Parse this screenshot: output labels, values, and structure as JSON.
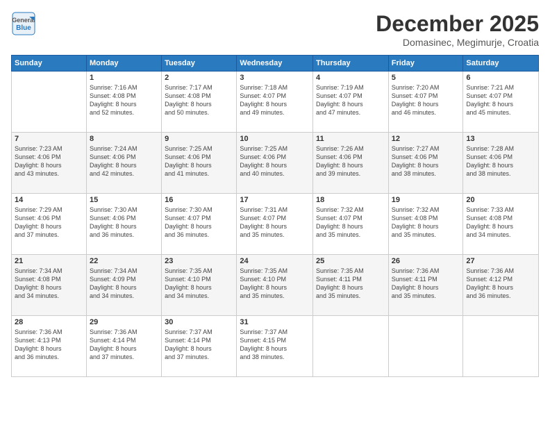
{
  "logo": {
    "general": "General",
    "blue": "Blue"
  },
  "header": {
    "month_year": "December 2025",
    "location": "Domasinec, Megimurje, Croatia"
  },
  "days_of_week": [
    "Sunday",
    "Monday",
    "Tuesday",
    "Wednesday",
    "Thursday",
    "Friday",
    "Saturday"
  ],
  "weeks": [
    [
      {
        "day": "",
        "sunrise": "",
        "sunset": "",
        "daylight": ""
      },
      {
        "day": "1",
        "sunrise": "Sunrise: 7:16 AM",
        "sunset": "Sunset: 4:08 PM",
        "daylight": "Daylight: 8 hours and 52 minutes."
      },
      {
        "day": "2",
        "sunrise": "Sunrise: 7:17 AM",
        "sunset": "Sunset: 4:08 PM",
        "daylight": "Daylight: 8 hours and 50 minutes."
      },
      {
        "day": "3",
        "sunrise": "Sunrise: 7:18 AM",
        "sunset": "Sunset: 4:07 PM",
        "daylight": "Daylight: 8 hours and 49 minutes."
      },
      {
        "day": "4",
        "sunrise": "Sunrise: 7:19 AM",
        "sunset": "Sunset: 4:07 PM",
        "daylight": "Daylight: 8 hours and 47 minutes."
      },
      {
        "day": "5",
        "sunrise": "Sunrise: 7:20 AM",
        "sunset": "Sunset: 4:07 PM",
        "daylight": "Daylight: 8 hours and 46 minutes."
      },
      {
        "day": "6",
        "sunrise": "Sunrise: 7:21 AM",
        "sunset": "Sunset: 4:07 PM",
        "daylight": "Daylight: 8 hours and 45 minutes."
      }
    ],
    [
      {
        "day": "7",
        "sunrise": "Sunrise: 7:23 AM",
        "sunset": "Sunset: 4:06 PM",
        "daylight": "Daylight: 8 hours and 43 minutes."
      },
      {
        "day": "8",
        "sunrise": "Sunrise: 7:24 AM",
        "sunset": "Sunset: 4:06 PM",
        "daylight": "Daylight: 8 hours and 42 minutes."
      },
      {
        "day": "9",
        "sunrise": "Sunrise: 7:25 AM",
        "sunset": "Sunset: 4:06 PM",
        "daylight": "Daylight: 8 hours and 41 minutes."
      },
      {
        "day": "10",
        "sunrise": "Sunrise: 7:25 AM",
        "sunset": "Sunset: 4:06 PM",
        "daylight": "Daylight: 8 hours and 40 minutes."
      },
      {
        "day": "11",
        "sunrise": "Sunrise: 7:26 AM",
        "sunset": "Sunset: 4:06 PM",
        "daylight": "Daylight: 8 hours and 39 minutes."
      },
      {
        "day": "12",
        "sunrise": "Sunrise: 7:27 AM",
        "sunset": "Sunset: 4:06 PM",
        "daylight": "Daylight: 8 hours and 38 minutes."
      },
      {
        "day": "13",
        "sunrise": "Sunrise: 7:28 AM",
        "sunset": "Sunset: 4:06 PM",
        "daylight": "Daylight: 8 hours and 38 minutes."
      }
    ],
    [
      {
        "day": "14",
        "sunrise": "Sunrise: 7:29 AM",
        "sunset": "Sunset: 4:06 PM",
        "daylight": "Daylight: 8 hours and 37 minutes."
      },
      {
        "day": "15",
        "sunrise": "Sunrise: 7:30 AM",
        "sunset": "Sunset: 4:06 PM",
        "daylight": "Daylight: 8 hours and 36 minutes."
      },
      {
        "day": "16",
        "sunrise": "Sunrise: 7:30 AM",
        "sunset": "Sunset: 4:07 PM",
        "daylight": "Daylight: 8 hours and 36 minutes."
      },
      {
        "day": "17",
        "sunrise": "Sunrise: 7:31 AM",
        "sunset": "Sunset: 4:07 PM",
        "daylight": "Daylight: 8 hours and 35 minutes."
      },
      {
        "day": "18",
        "sunrise": "Sunrise: 7:32 AM",
        "sunset": "Sunset: 4:07 PM",
        "daylight": "Daylight: 8 hours and 35 minutes."
      },
      {
        "day": "19",
        "sunrise": "Sunrise: 7:32 AM",
        "sunset": "Sunset: 4:08 PM",
        "daylight": "Daylight: 8 hours and 35 minutes."
      },
      {
        "day": "20",
        "sunrise": "Sunrise: 7:33 AM",
        "sunset": "Sunset: 4:08 PM",
        "daylight": "Daylight: 8 hours and 34 minutes."
      }
    ],
    [
      {
        "day": "21",
        "sunrise": "Sunrise: 7:34 AM",
        "sunset": "Sunset: 4:08 PM",
        "daylight": "Daylight: 8 hours and 34 minutes."
      },
      {
        "day": "22",
        "sunrise": "Sunrise: 7:34 AM",
        "sunset": "Sunset: 4:09 PM",
        "daylight": "Daylight: 8 hours and 34 minutes."
      },
      {
        "day": "23",
        "sunrise": "Sunrise: 7:35 AM",
        "sunset": "Sunset: 4:10 PM",
        "daylight": "Daylight: 8 hours and 34 minutes."
      },
      {
        "day": "24",
        "sunrise": "Sunrise: 7:35 AM",
        "sunset": "Sunset: 4:10 PM",
        "daylight": "Daylight: 8 hours and 35 minutes."
      },
      {
        "day": "25",
        "sunrise": "Sunrise: 7:35 AM",
        "sunset": "Sunset: 4:11 PM",
        "daylight": "Daylight: 8 hours and 35 minutes."
      },
      {
        "day": "26",
        "sunrise": "Sunrise: 7:36 AM",
        "sunset": "Sunset: 4:11 PM",
        "daylight": "Daylight: 8 hours and 35 minutes."
      },
      {
        "day": "27",
        "sunrise": "Sunrise: 7:36 AM",
        "sunset": "Sunset: 4:12 PM",
        "daylight": "Daylight: 8 hours and 36 minutes."
      }
    ],
    [
      {
        "day": "28",
        "sunrise": "Sunrise: 7:36 AM",
        "sunset": "Sunset: 4:13 PM",
        "daylight": "Daylight: 8 hours and 36 minutes."
      },
      {
        "day": "29",
        "sunrise": "Sunrise: 7:36 AM",
        "sunset": "Sunset: 4:14 PM",
        "daylight": "Daylight: 8 hours and 37 minutes."
      },
      {
        "day": "30",
        "sunrise": "Sunrise: 7:37 AM",
        "sunset": "Sunset: 4:14 PM",
        "daylight": "Daylight: 8 hours and 37 minutes."
      },
      {
        "day": "31",
        "sunrise": "Sunrise: 7:37 AM",
        "sunset": "Sunset: 4:15 PM",
        "daylight": "Daylight: 8 hours and 38 minutes."
      },
      {
        "day": "",
        "sunrise": "",
        "sunset": "",
        "daylight": ""
      },
      {
        "day": "",
        "sunrise": "",
        "sunset": "",
        "daylight": ""
      },
      {
        "day": "",
        "sunrise": "",
        "sunset": "",
        "daylight": ""
      }
    ]
  ]
}
